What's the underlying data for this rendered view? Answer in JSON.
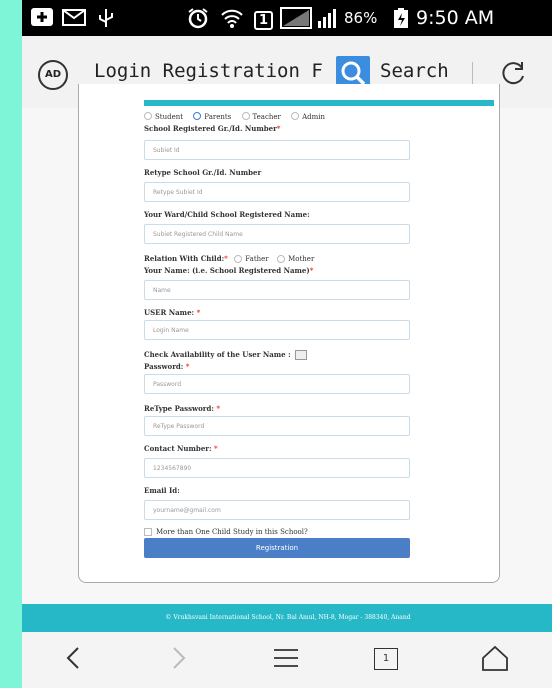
{
  "statusbar": {
    "icons": [
      "plus-icon",
      "mail-icon",
      "usb-icon",
      "alarm-icon",
      "wifi-icon",
      "sim-icon",
      "signal-icon",
      "battery-icon"
    ],
    "sim_number": "1",
    "battery": "86%",
    "time": "9:50 AM"
  },
  "browser": {
    "adblock_label": "AD",
    "page_title": "Login Registration F",
    "search_label": "Search"
  },
  "form": {
    "roles": [
      "Student",
      "Parents",
      "Teacher",
      "Admin"
    ],
    "selected_role": "Parents",
    "school_id_label": "School Registered Gr./Id. Number",
    "school_id_placeholder": "Subiet Id",
    "retype_id_label": "Retype School Gr./Id. Number",
    "retype_id_placeholder": "Retype Subiet Id",
    "ward_name_label": "Your Ward/Child School Registered Name:",
    "ward_name_placeholder": "Subiet Registered Child Name",
    "relation_label": "Relation With Child:",
    "relation_father": "Father",
    "relation_mother": "Mother",
    "your_name_label": "Your Name: (i.e. School Registered Name)",
    "your_name_placeholder": "Name",
    "user_name_label": "USER Name:",
    "user_name_placeholder": "Login Name",
    "availability_label": "Check Availability of the User Name :",
    "password_label": "Password:",
    "password_placeholder": "Password",
    "retype_password_label": "ReType Password:",
    "retype_password_placeholder": "ReType Password",
    "contact_label": "Contact Number:",
    "contact_placeholder": "1234567890",
    "email_label": "Email Id:",
    "email_placeholder": "yourname@gmail.com",
    "multi_child_label": "More than One Child Study in this School?",
    "submit_label": "Registration",
    "required_mark": "*"
  },
  "footer": {
    "text": "© Vrukhsvani International School, Nr. Bal Amul, NH-8, Mogar - 388340, Anand"
  },
  "navbar": {
    "tab_count": "1"
  },
  "colors": {
    "accent": "#26b8c7",
    "button": "#4a7fc8",
    "search": "#3b8de0",
    "background": "#7ff5d8"
  }
}
